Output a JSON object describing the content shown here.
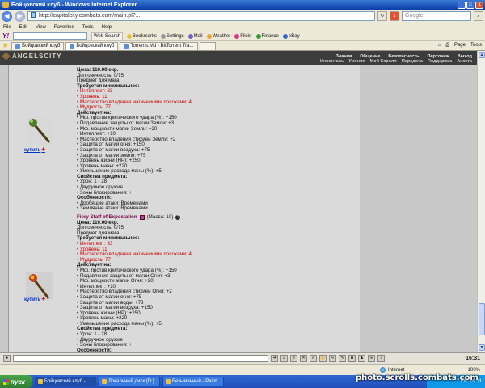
{
  "window": {
    "title": "Бойцовский клуб - Windows Internet Explorer",
    "minimize": "_",
    "maximize": "□",
    "close": "x"
  },
  "address": {
    "url": "http://capitalcity.combats.com/main.pl?...",
    "search_placeholder": "Google"
  },
  "menu": [
    "File",
    "Edit",
    "View",
    "Favorites",
    "Tools",
    "Help"
  ],
  "yahoo_toolbar": {
    "logo": "Y!",
    "search_button": "Web Search",
    "items": [
      "Bookmarks",
      "Settings",
      "Mail",
      "Weather",
      "Flickr",
      "Finance",
      "eBay"
    ]
  },
  "tabs": [
    {
      "label": "Бойцовский клуб"
    },
    {
      "label": "Бойцовский клуб"
    },
    {
      "label": "Torrents.Md - BitTorrent Tra..."
    },
    {
      "label": ""
    }
  ],
  "tab_tools": {
    "page": "Page",
    "tools": "Tools"
  },
  "site": {
    "logo": "ANGELSCITY",
    "nav_top": [
      "Знания",
      "Общение",
      "Безопасность",
      "Персонаж",
      "Выход"
    ],
    "nav_bottom": [
      "Инвентарь",
      "Умения",
      "Мой Скролл",
      "Передача",
      "Поддержка",
      "Анкета"
    ]
  },
  "items": [
    {
      "buy_label": "купить",
      "lines": [
        {
          "t": "Цена: 110.00 екр.",
          "c": "b"
        },
        {
          "t": "Долговечность: 0/75",
          "c": ""
        },
        {
          "t": "Предмет для мага",
          "c": ""
        },
        {
          "t": "Требуется минимальное:",
          "c": "b"
        },
        {
          "t": "• Интеллект: 33",
          "c": "red"
        },
        {
          "t": "• Уровень: 11",
          "c": "red"
        },
        {
          "t": "• Мастерство владения магическими посохами: 4",
          "c": "red"
        },
        {
          "t": "• Мудрость: 77",
          "c": "red"
        },
        {
          "t": "Действует на:",
          "c": "b"
        },
        {
          "t": "• Мф. против критического удара (%): +150",
          "c": ""
        },
        {
          "t": "• Подавление защиты от магии Земли: +3",
          "c": ""
        },
        {
          "t": "• Мф. мощности магии Земли: +20",
          "c": ""
        },
        {
          "t": "• Интеллект: +10",
          "c": ""
        },
        {
          "t": "• Мастерство владения стихией Земли: +2",
          "c": ""
        },
        {
          "t": "• Защита от магии огня: +150",
          "c": ""
        },
        {
          "t": "• Защита от магии воздуха: +75",
          "c": ""
        },
        {
          "t": "• Защита от магии земли: +75",
          "c": ""
        },
        {
          "t": "• Уровень жизни (HP): +250",
          "c": ""
        },
        {
          "t": "• Уровень маны: +220",
          "c": ""
        },
        {
          "t": "• Уменьшение расхода маны (%): +5",
          "c": ""
        },
        {
          "t": "Свойства предмета:",
          "c": "b"
        },
        {
          "t": "• Урон: 1 - 28",
          "c": ""
        },
        {
          "t": "• Двуручное оружие",
          "c": ""
        },
        {
          "t": "• Зоны блокирования: +",
          "c": ""
        },
        {
          "t": "Особенности:",
          "c": "b"
        },
        {
          "t": "• Дробящие атаки: Временами",
          "c": ""
        },
        {
          "t": "• Земляные атаки: Временами",
          "c": ""
        }
      ]
    },
    {
      "name": "Fiery Staff of Expectation",
      "mass": "(Масса: 10)",
      "buy_label": "купить",
      "lines": [
        {
          "t": "Цена: 110.00 екр.",
          "c": "b"
        },
        {
          "t": "Долговечность: 0/75",
          "c": ""
        },
        {
          "t": "Предмет для мага",
          "c": ""
        },
        {
          "t": "Требуется минимальное:",
          "c": "b"
        },
        {
          "t": "• Интеллект: 33",
          "c": "red"
        },
        {
          "t": "• Уровень: 11",
          "c": "red"
        },
        {
          "t": "• Мастерство владения магическими посохами: 4",
          "c": "red"
        },
        {
          "t": "• Мудрость: 77",
          "c": "red"
        },
        {
          "t": "Действует на:",
          "c": "b"
        },
        {
          "t": "• Мф. против критического удара (%): +150",
          "c": ""
        },
        {
          "t": "• Подавление защиты от магии Огня: +3",
          "c": ""
        },
        {
          "t": "• Мф. мощности магии Огня: +20",
          "c": ""
        },
        {
          "t": "• Интеллект: +10",
          "c": ""
        },
        {
          "t": "• Мастерство владения стихией Огня: +2",
          "c": ""
        },
        {
          "t": "• Защита от магии огня: +75",
          "c": ""
        },
        {
          "t": "• Защита от магии воды: +73",
          "c": ""
        },
        {
          "t": "• Защита от магии воздуха: +150",
          "c": ""
        },
        {
          "t": "• Уровень жизни (HP): +250",
          "c": ""
        },
        {
          "t": "• Уровень маны: +220",
          "c": ""
        },
        {
          "t": "• Уменьшение расхода маны (%): +5",
          "c": ""
        },
        {
          "t": "Свойства предмета:",
          "c": "b"
        },
        {
          "t": "• Урон: 1 - 28",
          "c": ""
        },
        {
          "t": "• Двуручное оружие",
          "c": ""
        },
        {
          "t": "• Зоны блокирования: +",
          "c": ""
        },
        {
          "t": "Особенности:",
          "c": "b"
        }
      ]
    }
  ],
  "chat": {
    "clock": "16:31"
  },
  "status": {
    "zone": "Internet",
    "zoom": "100%"
  },
  "taskbar": {
    "start": "пуск",
    "buttons": [
      "Бойцовский клуб - ...",
      "Локальный диск (D:)",
      "Безымянный - Paint"
    ],
    "lang": "EN",
    "time": "16:31"
  },
  "watermark": "photo.scrolls.combats.com"
}
